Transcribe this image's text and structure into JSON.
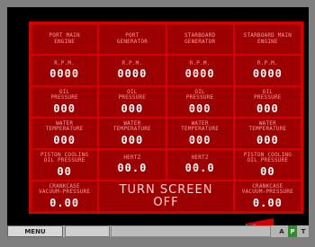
{
  "grid": [
    [
      {
        "label": "PORT MAIN\nENGINE"
      },
      {
        "label": "PORT\nGENERATOR"
      },
      {
        "label": "STARBOARD\nGENERATOR"
      },
      {
        "label": "STARBOARD MAIN\nENGINE"
      }
    ],
    [
      {
        "label": "R.P.M.",
        "value": "0000"
      },
      {
        "label": "R.P.M.",
        "value": "0000"
      },
      {
        "label": "R.P.M.",
        "value": "0000"
      },
      {
        "label": "R.P.M.",
        "value": "0000"
      }
    ],
    [
      {
        "label": "OIL\nPRESSURE",
        "value": "000"
      },
      {
        "label": "OIL\nPRESSURE",
        "value": "000"
      },
      {
        "label": "OIL\nPRESSURE",
        "value": "000"
      },
      {
        "label": "OIL\nPRESSURE",
        "value": "000"
      }
    ],
    [
      {
        "label": "WATER\nTEMPERATURE",
        "value": "000"
      },
      {
        "label": "WATER\nTEMPERATURE",
        "value": "000"
      },
      {
        "label": "WATER\nTEMPERATURE",
        "value": "000"
      },
      {
        "label": "WATER\nTEMPERATURE",
        "value": "000"
      }
    ],
    [
      {
        "label": "PISTON COOLING\nOIL PRESSURE",
        "value": "00"
      },
      {
        "label": "HERTZ",
        "value": "00.0"
      },
      {
        "label": "HERTZ",
        "value": "00.0"
      },
      {
        "label": "PISTON COOLING\nOIL PRESSURE",
        "value": "00"
      }
    ],
    [
      {
        "label": "CRANKCASE\nVACUUM-PRESSURE",
        "value": "0.00"
      },
      {
        "label": "TURN SCREEN\nOFF"
      },
      {
        "label": "CRANKCASE\nVACUUM-PRESSURE",
        "value": "0.00"
      }
    ]
  ],
  "back_button": {
    "label": "back",
    "icon": "back-arrow-icon"
  },
  "bottom_bar": {
    "menu_label": "MENU",
    "indicators": [
      {
        "label": "A"
      },
      {
        "label": "P",
        "active": true
      },
      {
        "label": "T"
      }
    ]
  },
  "colors": {
    "panel_red": "#9c0000",
    "grid_red": "#d40000",
    "label_pink": "#ff9a9a",
    "value_white": "#ffffff",
    "active_green": "#2f8d2f"
  }
}
